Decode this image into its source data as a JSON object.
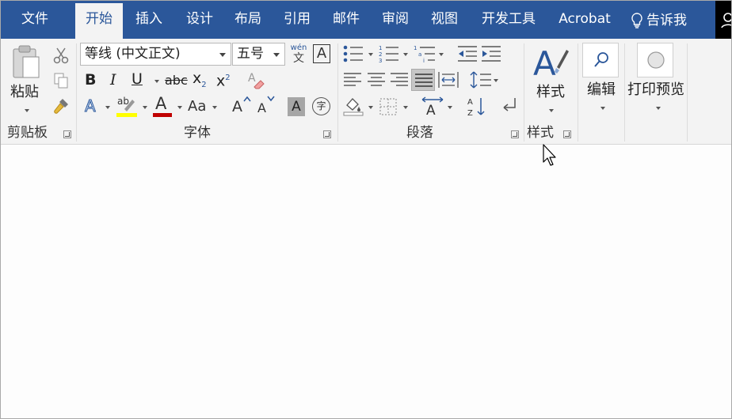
{
  "tabs": [
    {
      "label": "文件"
    },
    {
      "label": "开始"
    },
    {
      "label": "插入"
    },
    {
      "label": "设计"
    },
    {
      "label": "布局"
    },
    {
      "label": "引用"
    },
    {
      "label": "邮件"
    },
    {
      "label": "审阅"
    },
    {
      "label": "视图"
    },
    {
      "label": "开发工具"
    },
    {
      "label": "Acrobat"
    }
  ],
  "tell_me": {
    "label": "告诉我"
  },
  "clipboard": {
    "paste_label": "粘贴",
    "group_label": "剪贴板"
  },
  "font": {
    "name": "等线 (中文正文)",
    "size": "五号",
    "phonetic_top": "wén",
    "phonetic_bottom": "文",
    "border_char": "A",
    "bold": "B",
    "italic": "I",
    "underline": "U",
    "strike": "abc",
    "subscript_base": "x",
    "subscript_sub": "2",
    "superscript_base": "x",
    "superscript_sup": "2",
    "text_effect": "A",
    "highlight_text": "ab",
    "font_color_char": "A",
    "change_case": "Aa",
    "grow": "A",
    "shrink": "A",
    "shading_char": "A",
    "enclose_char": "字",
    "group_label": "字体"
  },
  "paragraph": {
    "group_label": "段落"
  },
  "styles": {
    "button_label": "样式",
    "group_label": "样式"
  },
  "editing": {
    "button_label": "编辑"
  },
  "print_preview": {
    "button_label": "打印预览"
  },
  "colors": {
    "title_bar": "#2b579a",
    "ribbon_bg": "#f3f3f3",
    "highlight_yellow": "#ffff00",
    "font_color_red": "#c00000",
    "accent_blue": "#2b579a"
  }
}
